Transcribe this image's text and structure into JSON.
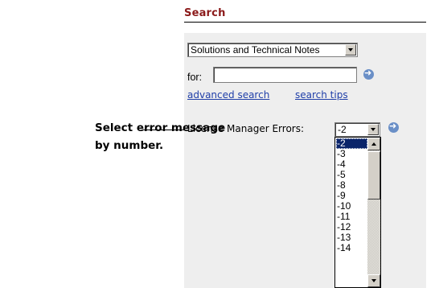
{
  "search": {
    "title": "Search",
    "category_selected": "Solutions and Technical Notes",
    "for_label": "for:",
    "query_value": "",
    "advanced_link": "advanced search",
    "tips_link": "search tips",
    "lm_label": "License Manager Errors:",
    "lm_selected": "-2",
    "lm_options": [
      "-2",
      "-3",
      "-4",
      "-5",
      "-8",
      "-9",
      "-10",
      "-11",
      "-12",
      "-13",
      "-14"
    ]
  },
  "annotation": {
    "line1": "Select error message",
    "line2": "by number."
  },
  "colors": {
    "title": "#8b1a1a",
    "panel": "#eeeeee",
    "link": "#1f3ea8",
    "selection": "#0a246a",
    "go_button": "#6a8fc7"
  },
  "icons": {
    "go_button": "arrow-right-circle-icon",
    "dropdown": "chevron-down-icon"
  }
}
